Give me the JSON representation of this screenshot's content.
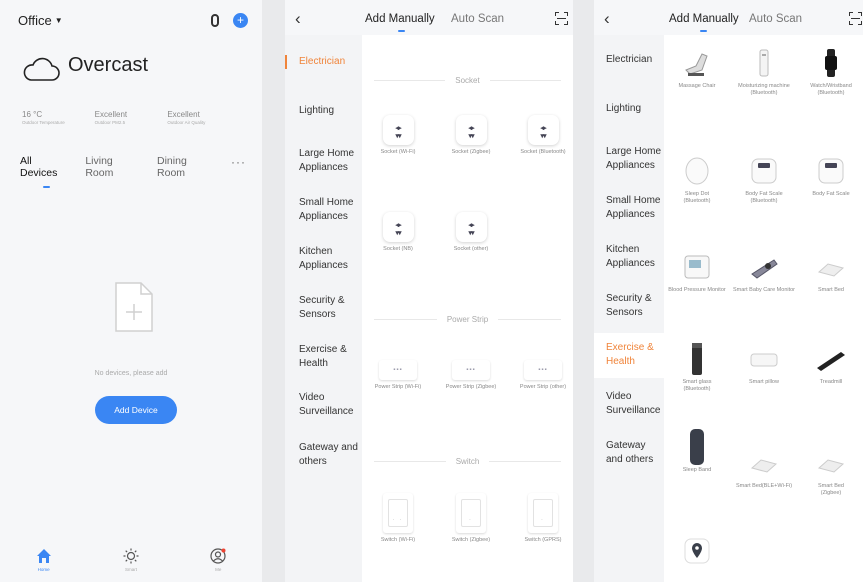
{
  "panel1": {
    "home_selector": "Office",
    "weather": "Overcast",
    "stats": [
      {
        "value": "16 °C",
        "label": "Outdoor Temperature"
      },
      {
        "value": "Excellent",
        "label": "Outdoor PM2.5"
      },
      {
        "value": "Excellent",
        "label": "Outdoor Air Quality"
      }
    ],
    "rooms": [
      "All Devices",
      "Living Room",
      "Dining Room"
    ],
    "more": "···",
    "empty_text": "No devices, please add",
    "add_button": "Add Device",
    "tabs": [
      {
        "label": "Home",
        "icon": "home-icon"
      },
      {
        "label": "Smart",
        "icon": "sun-icon"
      },
      {
        "label": "Me",
        "icon": "user-icon"
      }
    ]
  },
  "panel2": {
    "tab_manual": "Add Manually",
    "tab_scan": "Auto Scan",
    "categories": [
      "Electrician",
      "Lighting",
      "Large Home Appliances",
      "Small Home Appliances",
      "Kitchen Appliances",
      "Security & Sensors",
      "Exercise & Health",
      "Video Surveillance",
      "Gateway and others"
    ],
    "sections": {
      "socket": {
        "title": "Socket",
        "items": [
          "Socket (Wi-Fi)",
          "Socket (Zigbee)",
          "Socket (Bluetooth)",
          "Socket (NB)",
          "Socket (other)"
        ]
      },
      "power_strip": {
        "title": "Power Strip",
        "items": [
          "Power Strip (Wi-Fi)",
          "Power Strip (Zigbee)",
          "Power Strip (other)"
        ]
      },
      "switch": {
        "title": "Switch",
        "items": [
          "Switch (Wi-Fi)",
          "Switch (Zigbee)",
          "Switch (GPRS)"
        ]
      }
    }
  },
  "panel3": {
    "tab_manual": "Add Manually",
    "tab_scan": "Auto Scan",
    "categories": [
      "Electrician",
      "Lighting",
      "Large Home Appliances",
      "Small Home Appliances",
      "Kitchen Appliances",
      "Security & Sensors",
      "Exercise & Health",
      "Video Surveillance",
      "Gateway and others"
    ],
    "devices": [
      {
        "name": "Massage Chair",
        "sub": ""
      },
      {
        "name": "Moisturizing machine",
        "sub": "(Bluetooth)"
      },
      {
        "name": "Watch/Wristband",
        "sub": "(Bluetooth)"
      },
      {
        "name": "Sleep Dot",
        "sub": "(Bluetooth)"
      },
      {
        "name": "Body Fat Scale",
        "sub": "(Bluetooth)"
      },
      {
        "name": "Body Fat Scale",
        "sub": ""
      },
      {
        "name": "Blood Pressure Monitor",
        "sub": ""
      },
      {
        "name": "Smart Baby Care Monitor",
        "sub": ""
      },
      {
        "name": "Smart Bed",
        "sub": ""
      },
      {
        "name": "Smart glass",
        "sub": "(Bluetooth)"
      },
      {
        "name": "Smart pillow",
        "sub": ""
      },
      {
        "name": "Treadmill",
        "sub": ""
      },
      {
        "name": "Sleep Band",
        "sub": ""
      },
      {
        "name": "Smart Bed(BLE+Wi-Fi)",
        "sub": ""
      },
      {
        "name": "Smart Bed",
        "sub": "(Zigbee)"
      }
    ]
  },
  "colors": {
    "accent": "#3a86f3",
    "active_category": "#f0843a"
  }
}
